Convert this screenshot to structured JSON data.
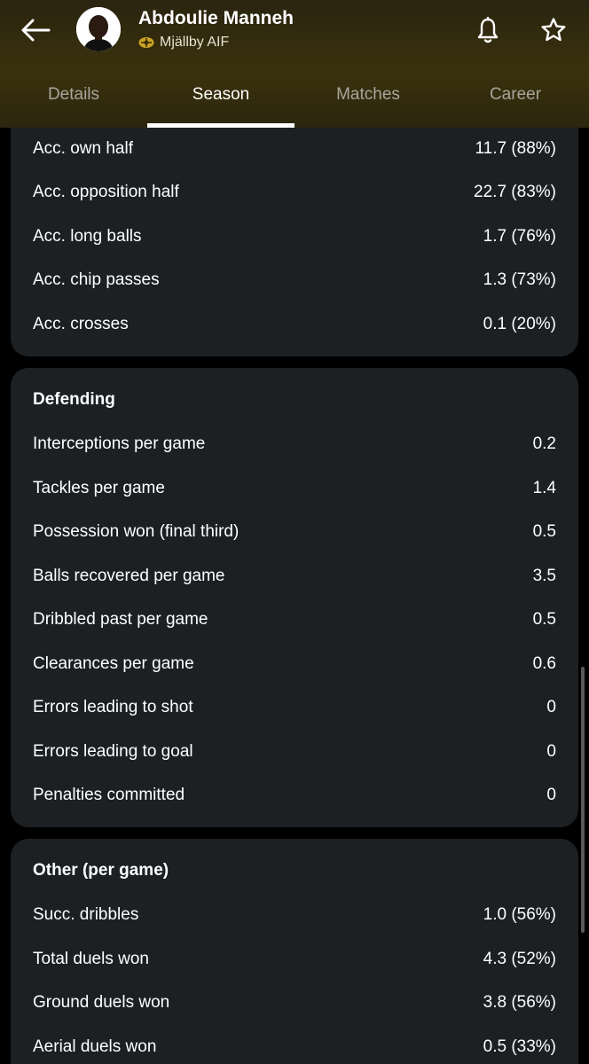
{
  "header": {
    "player_name": "Abdoulie Manneh",
    "club_name": "Mjällby AIF",
    "back_icon": "arrow-left-icon",
    "bell_icon": "bell-icon",
    "star_icon": "star-outline-icon"
  },
  "tabs": [
    {
      "label": "Details",
      "active": false
    },
    {
      "label": "Season",
      "active": true
    },
    {
      "label": "Matches",
      "active": false
    },
    {
      "label": "Career",
      "active": false
    }
  ],
  "passing_rows": [
    {
      "label": "Acc. own half",
      "value": "11.7 (88%)"
    },
    {
      "label": "Acc. opposition half",
      "value": "22.7 (83%)"
    },
    {
      "label": "Acc. long balls",
      "value": "1.7 (76%)"
    },
    {
      "label": "Acc. chip passes",
      "value": "1.3 (73%)"
    },
    {
      "label": "Acc. crosses",
      "value": "0.1 (20%)"
    }
  ],
  "defending": {
    "title": "Defending",
    "rows": [
      {
        "label": "Interceptions per game",
        "value": "0.2"
      },
      {
        "label": "Tackles per game",
        "value": "1.4"
      },
      {
        "label": "Possession won (final third)",
        "value": "0.5"
      },
      {
        "label": "Balls recovered per game",
        "value": "3.5"
      },
      {
        "label": "Dribbled past per game",
        "value": "0.5"
      },
      {
        "label": "Clearances per game",
        "value": "0.6"
      },
      {
        "label": "Errors leading to shot",
        "value": "0"
      },
      {
        "label": "Errors leading to goal",
        "value": "0"
      },
      {
        "label": "Penalties committed",
        "value": "0"
      }
    ]
  },
  "other": {
    "title": "Other (per game)",
    "rows": [
      {
        "label": "Succ. dribbles",
        "value": "1.0 (56%)"
      },
      {
        "label": "Total duels won",
        "value": "4.3 (52%)"
      },
      {
        "label": "Ground duels won",
        "value": "3.8 (56%)"
      },
      {
        "label": "Aerial duels won",
        "value": "0.5 (33%)"
      }
    ]
  },
  "colors": {
    "header_bg": "#3a310c",
    "card_bg": "#1c2023",
    "page_bg": "#000000",
    "tab_inactive": "#a8a69c",
    "club_badge": "#c9a227"
  }
}
